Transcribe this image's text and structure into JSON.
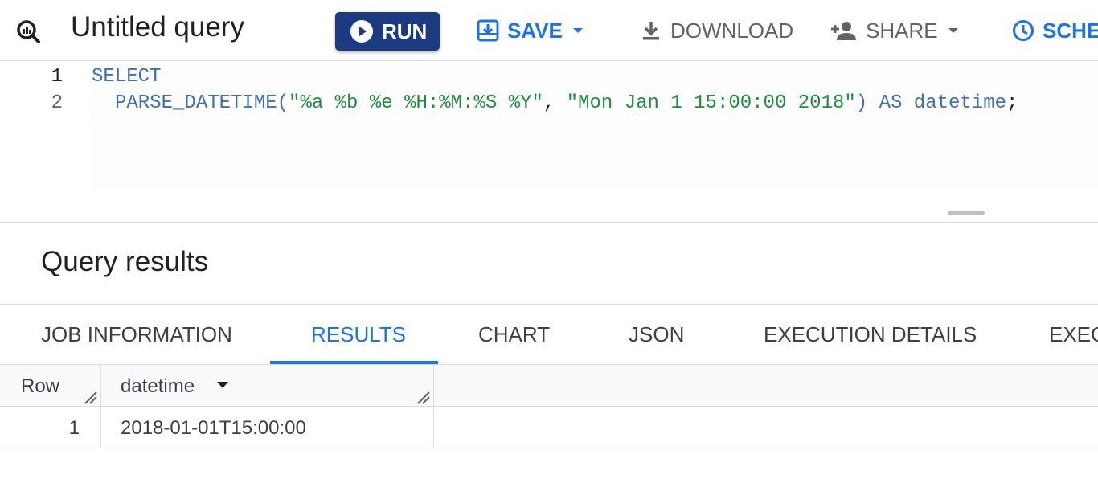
{
  "toolbar": {
    "title": "Untitled query",
    "run_label": "RUN",
    "save_label": "SAVE",
    "download_label": "DOWNLOAD",
    "share_label": "SHARE",
    "schedule_label": "SCHE"
  },
  "editor": {
    "lines": [
      {
        "number": "1",
        "keyword": "SELECT"
      },
      {
        "number": "2",
        "func": "PARSE_DATETIME(",
        "arg1": "\"%a %b %e %H:%M:%S %Y\"",
        "sep": ", ",
        "arg2": "\"Mon Jan 1 15:00:00 2018\"",
        "close": ")",
        "as_kw": " AS ",
        "alias": "datetime",
        "end": ";"
      }
    ]
  },
  "results": {
    "title": "Query results",
    "tabs": [
      "JOB INFORMATION",
      "RESULTS",
      "CHART",
      "JSON",
      "EXECUTION DETAILS",
      "EXEC"
    ],
    "active_tab": "RESULTS",
    "columns": [
      "Row",
      "datetime"
    ],
    "rows": [
      {
        "row": "1",
        "datetime": "2018-01-01T15:00:00"
      }
    ]
  },
  "colors": {
    "run_bg": "#1a3a82",
    "accent": "#1a73e8",
    "keyword": "#3d6fb5",
    "string": "#1e8e3e"
  },
  "icons": [
    "query-icon",
    "play-icon",
    "save-icon",
    "chevron-down-icon",
    "download-icon",
    "add-person-icon",
    "clock-icon",
    "sort-down-icon",
    "column-resize-icon"
  ]
}
